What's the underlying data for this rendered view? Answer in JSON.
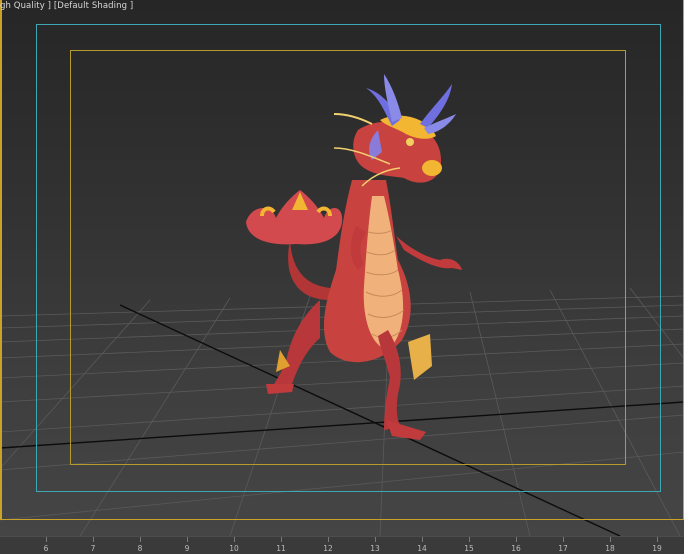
{
  "viewport": {
    "label": "gh Quality ] [Default Shading ]"
  },
  "timeline": {
    "ticks": [
      "6",
      "7",
      "8",
      "9",
      "10",
      "11",
      "12",
      "13",
      "14",
      "15",
      "16",
      "17",
      "18",
      "19"
    ]
  },
  "colors": {
    "safe_frame_outer": "#3fa7b3",
    "safe_frame_inner": "#b59a2e",
    "active_viewport_border": "#c9a227",
    "dragon_body": "#c8423f",
    "dragon_belly": "#f0b27a",
    "dragon_gold": "#f2b632",
    "dragon_horns": "#6f6fe0"
  }
}
